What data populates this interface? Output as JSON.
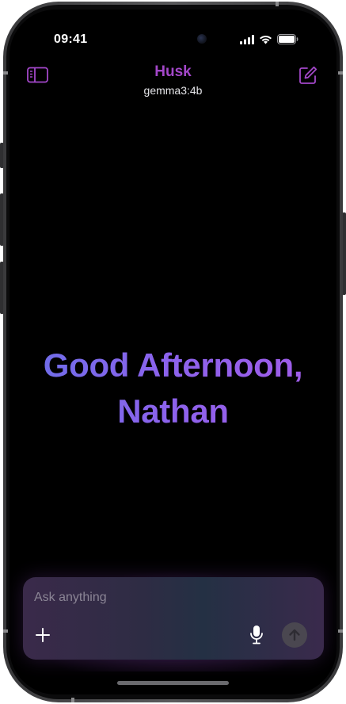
{
  "status_bar": {
    "time": "09:41",
    "icons": [
      "cellular-signal-icon",
      "wifi-icon",
      "battery-icon"
    ]
  },
  "header": {
    "title": "Husk",
    "model": "gemma3:4b",
    "left_icon": "sidebar-icon",
    "right_icon": "compose-icon"
  },
  "greeting": {
    "line1": "Good Afternoon,",
    "line2": "Nathan"
  },
  "composer": {
    "placeholder": "Ask anything",
    "value": "",
    "add_icon": "plus-icon",
    "mic_icon": "microphone-icon",
    "send_icon": "arrow-up-icon"
  },
  "colors": {
    "accent": "#a347c9",
    "greeting_gradient_start": "#6a6fe8",
    "greeting_gradient_end": "#a35be8",
    "background": "#000000"
  }
}
